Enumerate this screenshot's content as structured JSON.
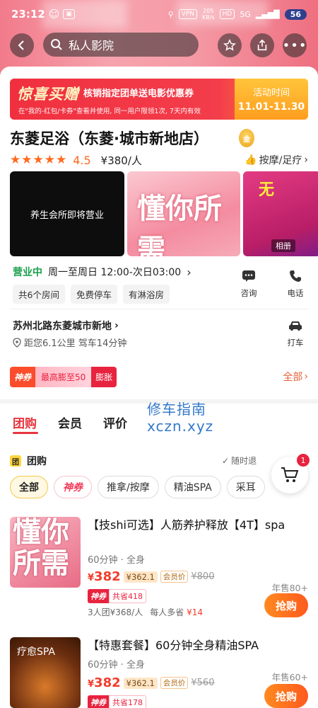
{
  "status_bar": {
    "time": "23:12",
    "vpn": "VPN",
    "speed": "205\nKB/s",
    "hd": "HD",
    "network": "5G",
    "battery": "56"
  },
  "nav": {
    "search_text": "私人影院"
  },
  "promo": {
    "brand": "惊喜买赠",
    "headline": "核销指定团单送电影优惠券",
    "note": "在\"我的-红包/卡券\"查看并使用, 同一用户限领1次, 7天内有效",
    "period_label": "活动时间",
    "period": "11.01-11.30"
  },
  "shop": {
    "name": "东菱足浴（东菱·城市新地店）",
    "badge": "金",
    "stars": "★★★★★",
    "rating": "4.5",
    "price_per_person": "¥380/人",
    "category": "按摩/足疗",
    "photo1_text": "养生会所即将营业",
    "photo2_text": "懂你所需",
    "photo3_text": "无",
    "album_label": "相册",
    "open_status": "营业中",
    "hours": "周一至周日 12:00-次日03:00",
    "features": [
      "共6个房间",
      "免费停车",
      "有淋浴房"
    ],
    "consult_label": "咨询",
    "phone_label": "电话",
    "address": "苏州北路东菱城市新地",
    "distance": "距您6.1公里 驾车14分钟",
    "drive_label": "打车"
  },
  "coupon_bar": {
    "shen_label": "神券",
    "max_text": "最高膨至50",
    "expand_label": "膨胀",
    "all_label": "全部"
  },
  "tabs": [
    "团购",
    "会员",
    "评价"
  ],
  "watermark": {
    "line1": "修车指南",
    "line2": "xczn.xyz"
  },
  "group": {
    "icon": "团",
    "title": "团购",
    "refund": "随时退",
    "cart_count": "1",
    "filters": [
      "全部",
      "神券",
      "推拿/按摩",
      "精油SPA",
      "采耳"
    ]
  },
  "deals": [
    {
      "title": "【技shi可选】人筋养护释放【4T】spa",
      "meta": "60分钟 · 全身",
      "image_text": "懂你所需",
      "price": "382",
      "vip_price": "¥362.1",
      "vip_label": "会员价",
      "original": "¥800",
      "shen_label": "神券",
      "save": "共省418",
      "team": "3人团¥368/人",
      "extra_prefix": "每人多省",
      "extra_amount": "¥14",
      "sold": "年售80+",
      "buy_label": "抢购"
    },
    {
      "title": "【特惠套餐】60分钟全身精油SPA",
      "meta": "60分钟 · 全身",
      "image_text": "疗愈SPA",
      "price": "382",
      "vip_price": "¥362.1",
      "vip_label": "会员价",
      "original": "¥560",
      "shen_label": "神券",
      "save": "共省178",
      "sold": "年售60+",
      "buy_label": "抢购"
    }
  ],
  "colors": {
    "accent": "#e8353e",
    "price": "#f23c2b",
    "open": "#19a04b",
    "buy": "#ff6a1f"
  }
}
